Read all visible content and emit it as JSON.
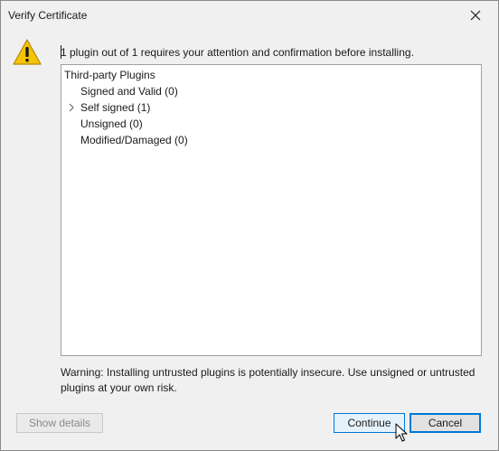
{
  "window": {
    "title": "Verify Certificate"
  },
  "message": "1 plugin out of 1 requires your attention and confirmation before installing.",
  "tree": {
    "root_label": "Third-party Plugins",
    "children": [
      {
        "label": "Signed and Valid (0)"
      },
      {
        "label": "Self signed (1)"
      },
      {
        "label": "Unsigned (0)"
      },
      {
        "label": "Modified/Damaged (0)"
      }
    ]
  },
  "warning": "Warning: Installing untrusted plugins is potentially insecure. Use unsigned or untrusted plugins at your own risk.",
  "buttons": {
    "show_details": "Show details",
    "continue": "Continue",
    "cancel": "Cancel"
  },
  "icons": {
    "warning": "warning-triangle-icon",
    "close": "close-icon",
    "expander": "chevron-right-icon",
    "cursor": "mouse-pointer-icon"
  },
  "colors": {
    "accent": "#0078d7",
    "warning_fill": "#f5c400",
    "dialog_bg": "#f0f0f0"
  }
}
